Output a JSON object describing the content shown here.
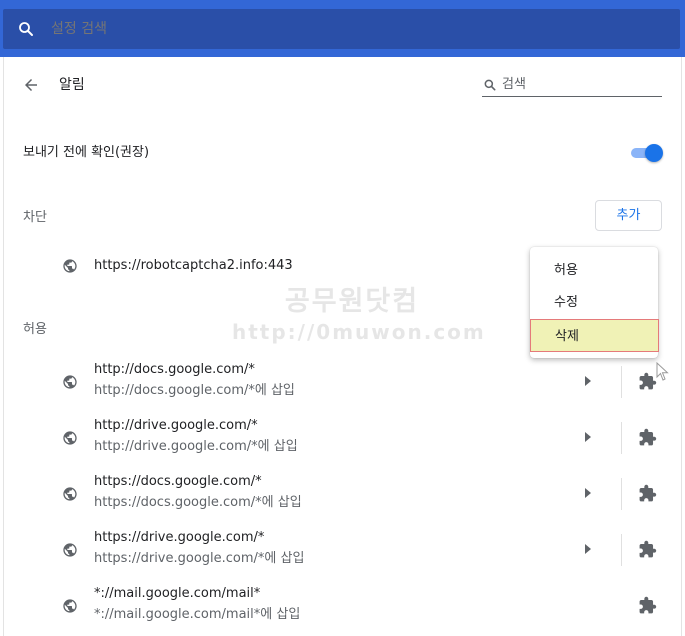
{
  "search": {
    "placeholder": "설정 검색"
  },
  "header": {
    "title": "알림",
    "search_placeholder": "검색"
  },
  "confirm_setting": {
    "label": "보내기 전에 확인(권장)",
    "enabled": true
  },
  "block": {
    "heading": "차단",
    "add_label": "추가",
    "sites": [
      {
        "name": "https://robotcaptcha2.info:443"
      }
    ]
  },
  "allow": {
    "heading": "허용",
    "sites": [
      {
        "name": "http://docs.google.com/*",
        "sub": "http://docs.google.com/*에 삽입"
      },
      {
        "name": "http://drive.google.com/*",
        "sub": "http://drive.google.com/*에 삽입"
      },
      {
        "name": "https://docs.google.com/*",
        "sub": "https://docs.google.com/*에 삽입"
      },
      {
        "name": "https://drive.google.com/*",
        "sub": "https://drive.google.com/*에 삽입"
      },
      {
        "name": "*://mail.google.com/mail*",
        "sub": "*://mail.google.com/mail*에 삽입"
      }
    ]
  },
  "context_menu": {
    "items": [
      {
        "label": "허용"
      },
      {
        "label": "수정"
      },
      {
        "label": "삭제"
      }
    ],
    "active": "삭제"
  },
  "watermark": {
    "line1": "공무원닷컴",
    "line2": "http://0muwon.com"
  },
  "colors": {
    "topbar": "#3367d6",
    "accent": "#1a73e8",
    "highlight": "#f0f2b6"
  }
}
